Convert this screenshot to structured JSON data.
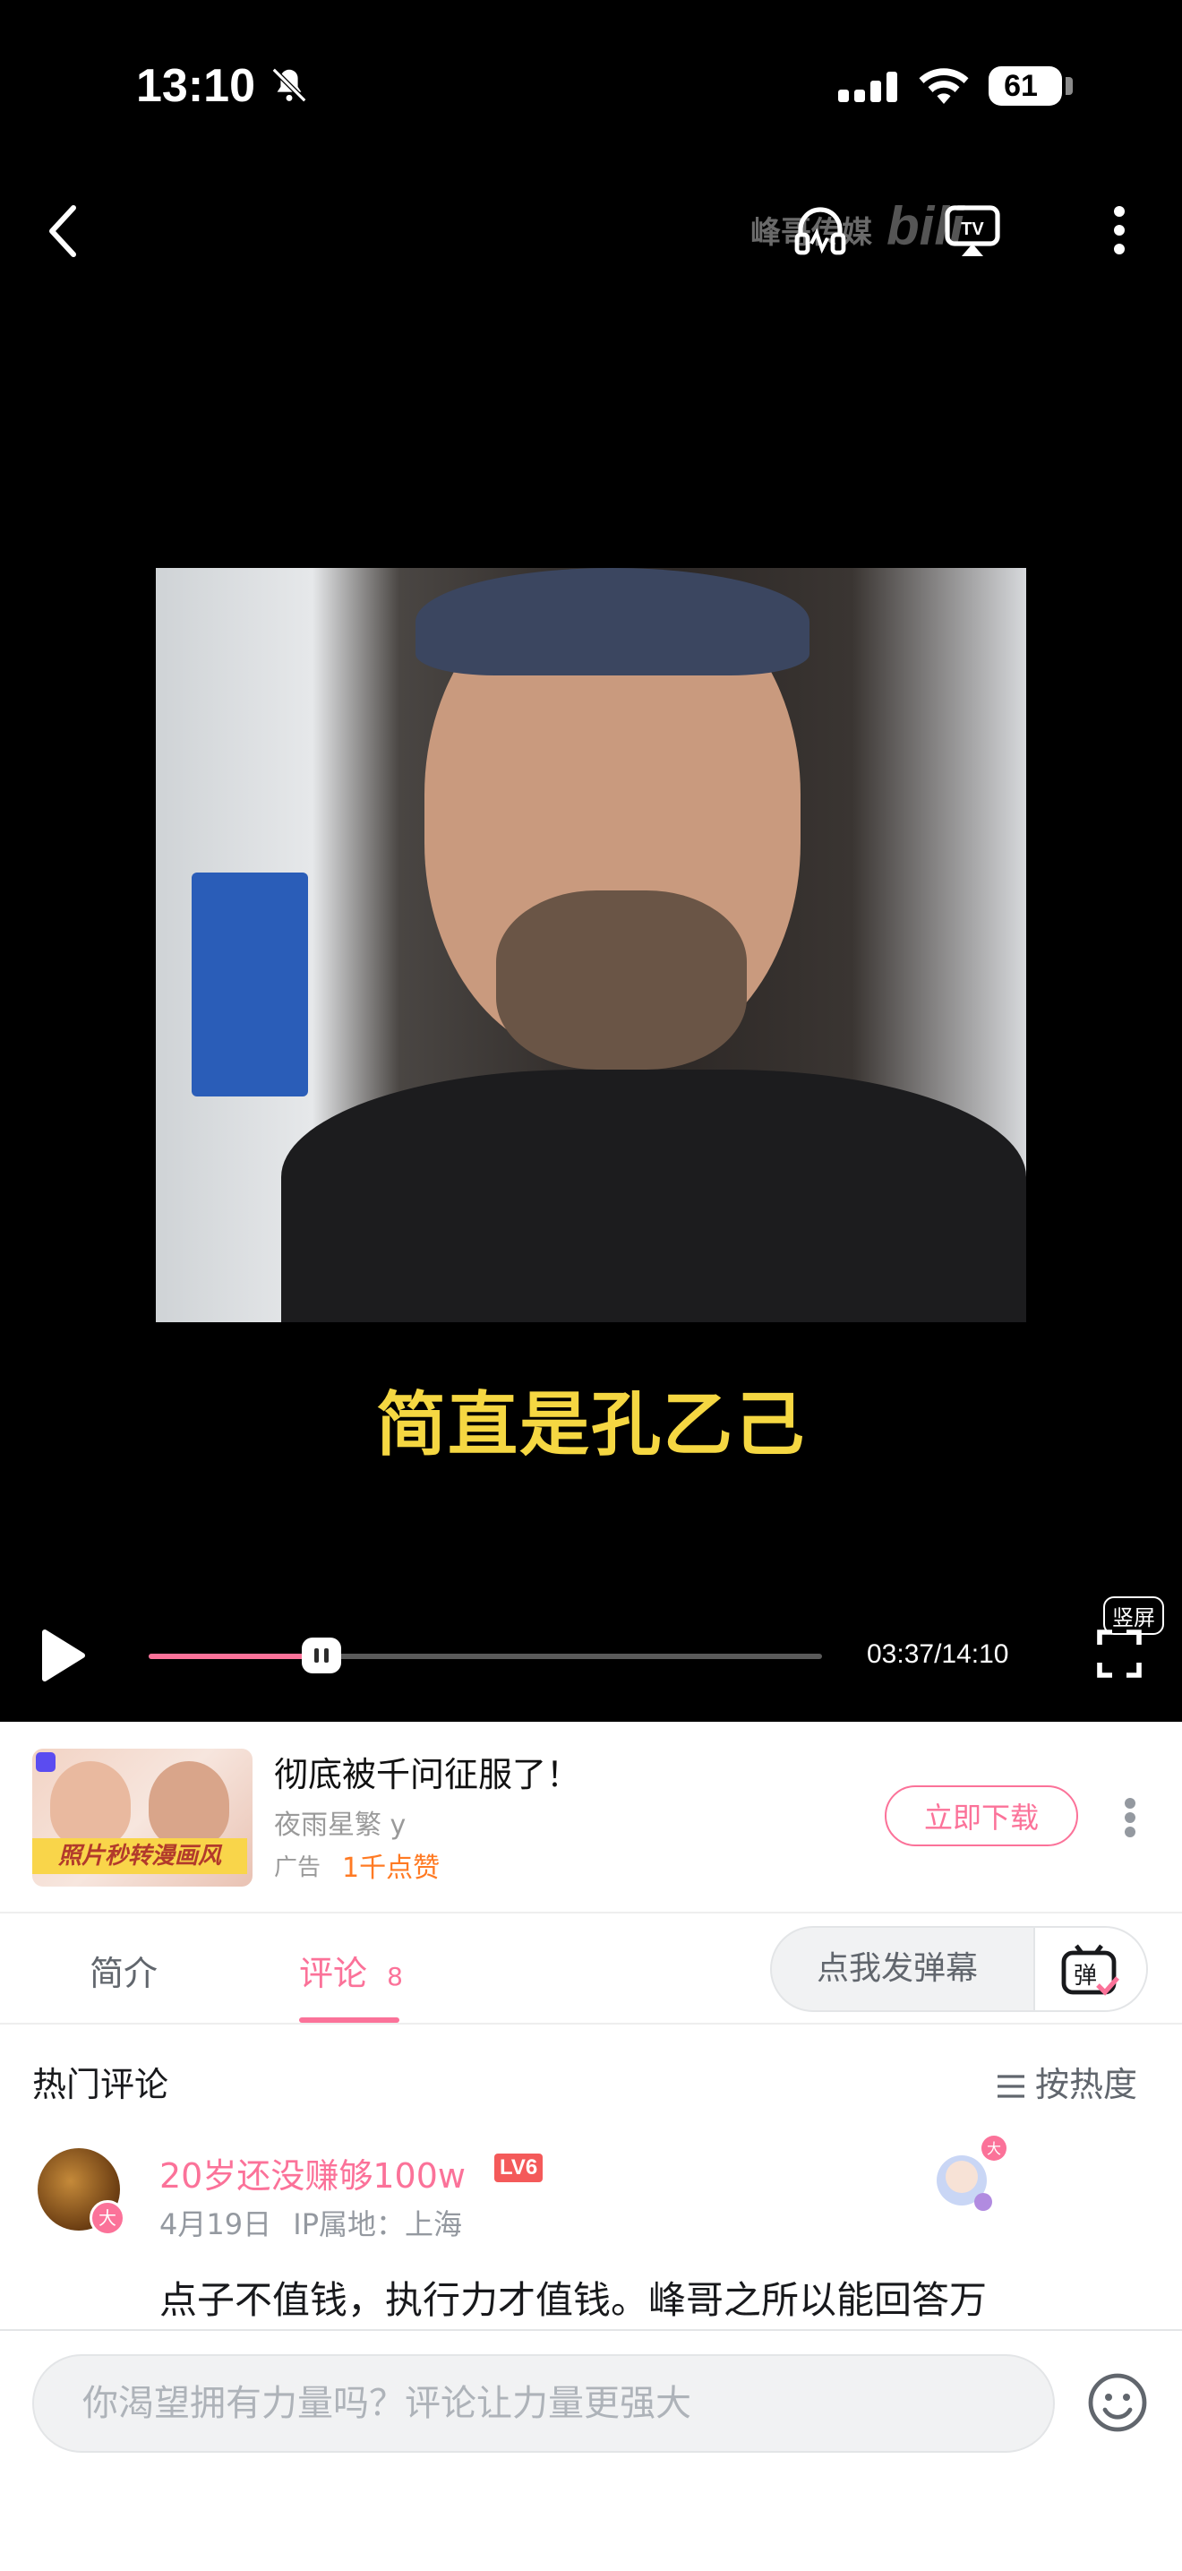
{
  "status_bar": {
    "time": "13:10",
    "battery": "61"
  },
  "video": {
    "watermark": "峰哥",
    "watermark_suffix": "传媒",
    "caption": "简直是孔乙己",
    "current_time": "03:37",
    "total_time": "14:10",
    "time_display": "03:37/14:10",
    "progress_fraction": 0.257,
    "vertical_label": "竖屏"
  },
  "ad": {
    "image_banner": "照片秒转漫画风",
    "title": "彻底被千问征服了！",
    "author": "夜雨星繁 y",
    "tag": "广告",
    "likes": "1千点赞",
    "download_label": "立即下载"
  },
  "tabs": {
    "intro": "简介",
    "comments": "评论",
    "comment_count": "8",
    "danmaku_placeholder": "点我发弹幕",
    "danmaku_icon": "弹"
  },
  "comments_section": {
    "title": "热门评论",
    "sort_label": "按热度",
    "items": [
      {
        "user": "20岁还没赚够100w",
        "level": "LV6",
        "date": "4月19日",
        "ip": "IP属地：上海",
        "text": "点子不值钱，执行力才值钱。峰哥之所以能回答万"
      }
    ]
  },
  "input": {
    "placeholder": "你渴望拥有力量吗？评论让力量更强大"
  },
  "colors": {
    "accent": "#fb7299",
    "caption": "#f5d742",
    "likes": "#ff7a23"
  }
}
